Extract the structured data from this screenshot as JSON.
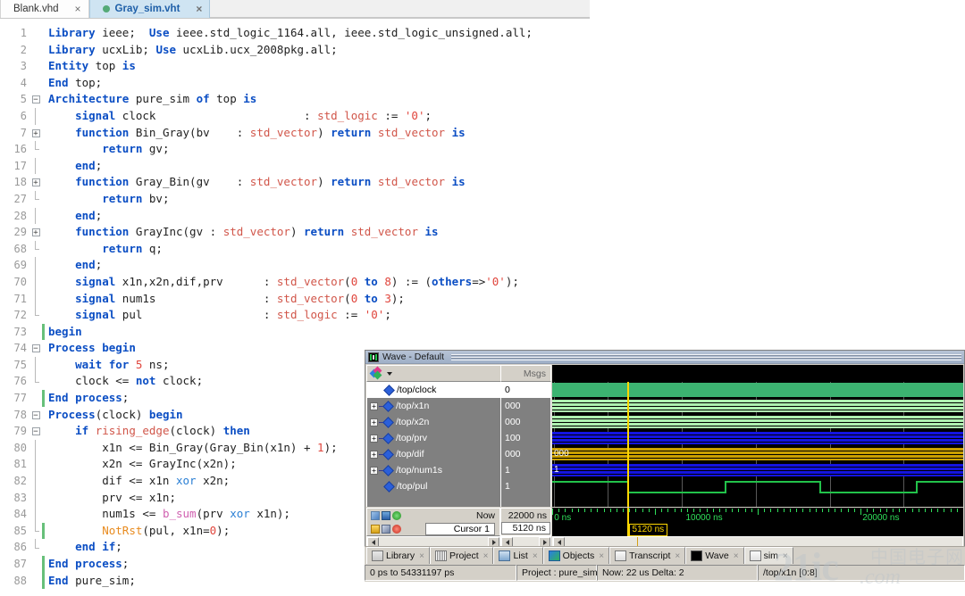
{
  "editor": {
    "tabs": [
      {
        "label": "Blank.vhd",
        "active": false,
        "modified": false,
        "close": "×"
      },
      {
        "label": "Gray_sim.vht",
        "active": true,
        "modified": true,
        "close": "×"
      }
    ],
    "lines": [
      {
        "num": "1",
        "fold": "",
        "bar": "",
        "accent": "",
        "tokens": [
          [
            "kw",
            "Library "
          ],
          [
            "pln",
            "ieee"
          ],
          [
            "punc",
            ";  "
          ],
          [
            "kw",
            "Use "
          ],
          [
            "pln",
            "ieee"
          ],
          [
            "punc",
            "."
          ],
          [
            "pln",
            "std_logic_1164"
          ],
          [
            "punc",
            "."
          ],
          [
            "pln",
            "all"
          ],
          [
            "punc",
            ", "
          ],
          [
            "pln",
            "ieee"
          ],
          [
            "punc",
            "."
          ],
          [
            "pln",
            "std_logic_unsigned"
          ],
          [
            "punc",
            "."
          ],
          [
            "pln",
            "all"
          ],
          [
            "punc",
            ";"
          ]
        ]
      },
      {
        "num": "2",
        "fold": "",
        "bar": "",
        "accent": "",
        "tokens": [
          [
            "kw",
            "Library "
          ],
          [
            "pln",
            "ucxLib"
          ],
          [
            "punc",
            "; "
          ],
          [
            "kw",
            "Use "
          ],
          [
            "pln",
            "ucxLib"
          ],
          [
            "punc",
            "."
          ],
          [
            "pln",
            "ucx_2008pkg"
          ],
          [
            "punc",
            "."
          ],
          [
            "pln",
            "all"
          ],
          [
            "punc",
            ";"
          ]
        ]
      },
      {
        "num": "3",
        "fold": "",
        "bar": "",
        "accent": "",
        "tokens": [
          [
            "kw",
            "Entity "
          ],
          [
            "pln",
            "top "
          ],
          [
            "kw",
            "is"
          ]
        ]
      },
      {
        "num": "4",
        "fold": "",
        "bar": "",
        "accent": "",
        "tokens": [
          [
            "kw",
            "End "
          ],
          [
            "pln",
            "top;"
          ]
        ]
      },
      {
        "num": "5",
        "fold": "minus",
        "bar": "",
        "accent": "",
        "tokens": [
          [
            "kw",
            "Architecture "
          ],
          [
            "pln",
            "pure_sim "
          ],
          [
            "kw",
            "of "
          ],
          [
            "pln",
            "top "
          ],
          [
            "kw",
            "is"
          ]
        ]
      },
      {
        "num": "6",
        "fold": "line",
        "bar": "",
        "accent": "",
        "tokens": [
          [
            "pln",
            "    "
          ],
          [
            "kw",
            "signal "
          ],
          [
            "pln",
            "clock                      "
          ],
          [
            "punc",
            ": "
          ],
          [
            "typ",
            "std_logic "
          ],
          [
            "punc",
            ":= "
          ],
          [
            "str",
            "'0'"
          ],
          [
            "punc",
            ";"
          ]
        ]
      },
      {
        "num": "7",
        "fold": "plus",
        "bar": "",
        "accent": "",
        "tokens": [
          [
            "pln",
            "    "
          ],
          [
            "kw",
            "function "
          ],
          [
            "pln",
            "Bin_Gray(bv    "
          ],
          [
            "punc",
            ": "
          ],
          [
            "typ",
            "std_vector"
          ],
          [
            "punc",
            ") "
          ],
          [
            "kw",
            "return "
          ],
          [
            "typ",
            "std_vector "
          ],
          [
            "kw",
            "is"
          ]
        ]
      },
      {
        "num": "16",
        "fold": "end",
        "bar": "",
        "accent": "",
        "tokens": [
          [
            "pln",
            "        "
          ],
          [
            "kw",
            "return "
          ],
          [
            "pln",
            "gv;"
          ]
        ]
      },
      {
        "num": "17",
        "fold": "line",
        "bar": "",
        "accent": "",
        "tokens": [
          [
            "pln",
            "    "
          ],
          [
            "kw",
            "end"
          ],
          [
            "punc",
            ";"
          ]
        ]
      },
      {
        "num": "18",
        "fold": "plus",
        "bar": "",
        "accent": "",
        "tokens": [
          [
            "pln",
            "    "
          ],
          [
            "kw",
            "function "
          ],
          [
            "pln",
            "Gray_Bin(gv    "
          ],
          [
            "punc",
            ": "
          ],
          [
            "typ",
            "std_vector"
          ],
          [
            "punc",
            ") "
          ],
          [
            "kw",
            "return "
          ],
          [
            "typ",
            "std_vector "
          ],
          [
            "kw",
            "is"
          ]
        ]
      },
      {
        "num": "27",
        "fold": "end",
        "bar": "",
        "accent": "",
        "tokens": [
          [
            "pln",
            "        "
          ],
          [
            "kw",
            "return "
          ],
          [
            "pln",
            "bv;"
          ]
        ]
      },
      {
        "num": "28",
        "fold": "line",
        "bar": "",
        "accent": "",
        "tokens": [
          [
            "pln",
            "    "
          ],
          [
            "kw",
            "end"
          ],
          [
            "punc",
            ";"
          ]
        ]
      },
      {
        "num": "29",
        "fold": "plus",
        "bar": "",
        "accent": "",
        "tokens": [
          [
            "pln",
            "    "
          ],
          [
            "kw",
            "function "
          ],
          [
            "pln",
            "GrayInc(gv "
          ],
          [
            "punc",
            ": "
          ],
          [
            "typ",
            "std_vector"
          ],
          [
            "punc",
            ") "
          ],
          [
            "kw",
            "return "
          ],
          [
            "typ",
            "std_vector "
          ],
          [
            "kw",
            "is"
          ]
        ]
      },
      {
        "num": "68",
        "fold": "end",
        "bar": "",
        "accent": "",
        "tokens": [
          [
            "pln",
            "        "
          ],
          [
            "kw",
            "return "
          ],
          [
            "pln",
            "q;"
          ]
        ]
      },
      {
        "num": "69",
        "fold": "line",
        "bar": "",
        "accent": "",
        "tokens": [
          [
            "pln",
            "    "
          ],
          [
            "kw",
            "end"
          ],
          [
            "punc",
            ";"
          ]
        ]
      },
      {
        "num": "70",
        "fold": "line",
        "bar": "",
        "accent": "",
        "tokens": [
          [
            "pln",
            "    "
          ],
          [
            "kw",
            "signal "
          ],
          [
            "pln",
            "x1n,x2n,dif,prv      "
          ],
          [
            "punc",
            ": "
          ],
          [
            "typ",
            "std_vector"
          ],
          [
            "punc",
            "("
          ],
          [
            "num",
            "0"
          ],
          [
            "kw",
            " to "
          ],
          [
            "num",
            "8"
          ],
          [
            "punc",
            ") := ("
          ],
          [
            "kw",
            "others"
          ],
          [
            "punc",
            "=>"
          ],
          [
            "str",
            "'0'"
          ],
          [
            "punc",
            ");"
          ]
        ]
      },
      {
        "num": "71",
        "fold": "line",
        "bar": "",
        "accent": "",
        "tokens": [
          [
            "pln",
            "    "
          ],
          [
            "kw",
            "signal "
          ],
          [
            "pln",
            "num1s                "
          ],
          [
            "punc",
            ": "
          ],
          [
            "typ",
            "std_vector"
          ],
          [
            "punc",
            "("
          ],
          [
            "num",
            "0"
          ],
          [
            "kw",
            " to "
          ],
          [
            "num",
            "3"
          ],
          [
            "punc",
            ");"
          ]
        ]
      },
      {
        "num": "72",
        "fold": "endl",
        "bar": "",
        "accent": "",
        "tokens": [
          [
            "pln",
            "    "
          ],
          [
            "kw",
            "signal "
          ],
          [
            "pln",
            "pul                  "
          ],
          [
            "punc",
            ": "
          ],
          [
            "typ",
            "std_logic "
          ],
          [
            "punc",
            ":= "
          ],
          [
            "str",
            "'0'"
          ],
          [
            "punc",
            ";"
          ]
        ]
      },
      {
        "num": "73",
        "fold": "",
        "bar": "",
        "accent": "green",
        "tokens": [
          [
            "kw",
            "begin"
          ]
        ]
      },
      {
        "num": "74",
        "fold": "minus",
        "bar": "",
        "accent": "",
        "tokens": [
          [
            "kw",
            "Process "
          ],
          [
            "kw",
            "begin"
          ]
        ]
      },
      {
        "num": "75",
        "fold": "line",
        "bar": "",
        "accent": "",
        "tokens": [
          [
            "pln",
            "    "
          ],
          [
            "kw",
            "wait for "
          ],
          [
            "num",
            "5"
          ],
          [
            "pln",
            " ns;"
          ]
        ]
      },
      {
        "num": "76",
        "fold": "end",
        "bar": "",
        "accent": "",
        "tokens": [
          [
            "pln",
            "    clock <= "
          ],
          [
            "kw",
            "not "
          ],
          [
            "pln",
            "clock;"
          ]
        ]
      },
      {
        "num": "77",
        "fold": "",
        "bar": "",
        "accent": "green",
        "tokens": [
          [
            "kw",
            "End process"
          ],
          [
            "punc",
            ";"
          ]
        ]
      },
      {
        "num": "78",
        "fold": "minus",
        "bar": "",
        "accent": "",
        "tokens": [
          [
            "kw",
            "Process"
          ],
          [
            "punc",
            "("
          ],
          [
            "pln",
            "clock"
          ],
          [
            "punc",
            ") "
          ],
          [
            "kw",
            "begin"
          ]
        ]
      },
      {
        "num": "79",
        "fold": "minus2",
        "bar": "",
        "accent": "",
        "tokens": [
          [
            "pln",
            "    "
          ],
          [
            "kw",
            "if "
          ],
          [
            "typ",
            "rising_edge"
          ],
          [
            "punc",
            "("
          ],
          [
            "pln",
            "clock"
          ],
          [
            "punc",
            ") "
          ],
          [
            "kw",
            "then"
          ]
        ]
      },
      {
        "num": "80",
        "fold": "line",
        "bar": "",
        "accent": "",
        "tokens": [
          [
            "pln",
            "        x1n <= Bin_Gray(Gray_Bin(x1n) + "
          ],
          [
            "num",
            "1"
          ],
          [
            "punc",
            ");"
          ]
        ]
      },
      {
        "num": "81",
        "fold": "line",
        "bar": "",
        "accent": "",
        "tokens": [
          [
            "pln",
            "        x2n <= GrayInc(x2n);"
          ]
        ]
      },
      {
        "num": "82",
        "fold": "line",
        "bar": "",
        "accent": "",
        "tokens": [
          [
            "pln",
            "        dif <= x1n "
          ],
          [
            "xor",
            "xor"
          ],
          [
            "pln",
            " x2n;"
          ]
        ]
      },
      {
        "num": "83",
        "fold": "line",
        "bar": "",
        "accent": "",
        "tokens": [
          [
            "pln",
            "        prv <= x1n;"
          ]
        ]
      },
      {
        "num": "84",
        "fold": "line",
        "bar": "",
        "accent": "",
        "tokens": [
          [
            "pln",
            "        num1s <= "
          ],
          [
            "fnp",
            "b_sum"
          ],
          [
            "punc",
            "("
          ],
          [
            "pln",
            "prv "
          ],
          [
            "xor",
            "xor"
          ],
          [
            "pln",
            " x1n"
          ],
          [
            "punc",
            ");"
          ]
        ]
      },
      {
        "num": "85",
        "fold": "end",
        "bar": "",
        "accent": "green",
        "tokens": [
          [
            "pln",
            "        "
          ],
          [
            "fn",
            "NotRst"
          ],
          [
            "punc",
            "("
          ],
          [
            "pln",
            "pul, x1n="
          ],
          [
            "num",
            "0"
          ],
          [
            "punc",
            ");"
          ]
        ]
      },
      {
        "num": "86",
        "fold": "end",
        "bar": "",
        "accent": "",
        "tokens": [
          [
            "pln",
            "    "
          ],
          [
            "kw",
            "end if"
          ],
          [
            "punc",
            ";"
          ]
        ]
      },
      {
        "num": "87",
        "fold": "",
        "bar": "",
        "accent": "green",
        "tokens": [
          [
            "kw",
            "End process"
          ],
          [
            "punc",
            ";"
          ]
        ]
      },
      {
        "num": "88",
        "fold": "",
        "bar": "",
        "accent": "green",
        "tokens": [
          [
            "kw",
            "End "
          ],
          [
            "pln",
            "pure_sim;"
          ]
        ]
      }
    ]
  },
  "wave": {
    "title": "Wave - Default",
    "names_header_icon": "palette-icon",
    "msgs_header": "Msgs",
    "signals": [
      {
        "name": "/top/clock",
        "value": "0",
        "expandable": false,
        "selected": true,
        "type": "logic",
        "color": "#3cb371"
      },
      {
        "name": "/top/x1n",
        "value": "000",
        "expandable": true,
        "selected": false,
        "type": "vector",
        "color": "#aef0b0"
      },
      {
        "name": "/top/x2n",
        "value": "000",
        "expandable": true,
        "selected": false,
        "type": "vector",
        "color": "#aef0b0"
      },
      {
        "name": "/top/prv",
        "value": "100",
        "expandable": true,
        "selected": false,
        "type": "vector",
        "color": "#1414e0"
      },
      {
        "name": "/top/dif",
        "value": "000",
        "expandable": true,
        "selected": false,
        "type": "vector",
        "color": "#caa000",
        "label": "000"
      },
      {
        "name": "/top/num1s",
        "value": "1",
        "expandable": true,
        "selected": false,
        "type": "vector",
        "color": "#1414e0",
        "label": "1"
      },
      {
        "name": "/top/pul",
        "value": "1",
        "expandable": false,
        "selected": false,
        "type": "pulse",
        "color": "#22c24a"
      }
    ],
    "controls": {
      "now_label": "Now",
      "now_value": "22000 ns",
      "cursor_label": "Cursor 1",
      "cursor_value": "5120 ns"
    },
    "ruler": {
      "labels": [
        {
          "text": "0 ns",
          "pct": 0.5
        },
        {
          "text": "10000 ns",
          "pct": 32.5
        },
        {
          "text": "20000 ns",
          "pct": 75.5
        }
      ],
      "cursor_flag": "5120 ns",
      "cursor_pct": 18.2
    }
  },
  "bottom_tabs": [
    {
      "label": "Library",
      "icon": "library-icon",
      "active": false
    },
    {
      "label": "Project",
      "icon": "project-icon",
      "active": false
    },
    {
      "label": "List",
      "icon": "list-icon",
      "active": false
    },
    {
      "label": "Objects",
      "icon": "objects-icon",
      "active": false
    },
    {
      "label": "Transcript",
      "icon": "transcript-icon",
      "active": false
    },
    {
      "label": "Wave",
      "icon": "wave-icon",
      "active": false
    },
    {
      "label": "sim",
      "icon": "sim-icon",
      "active": true
    }
  ],
  "status": {
    "range": "0 ps to 54331197 ps",
    "project": "Project : pure_sim",
    "now": "Now: 22 us  Delta: 2",
    "selected_object": "/top/x1n [0:8]"
  },
  "watermark": {
    "brand": "21ic",
    "cn": "中国电子网",
    "domain": ".com"
  }
}
